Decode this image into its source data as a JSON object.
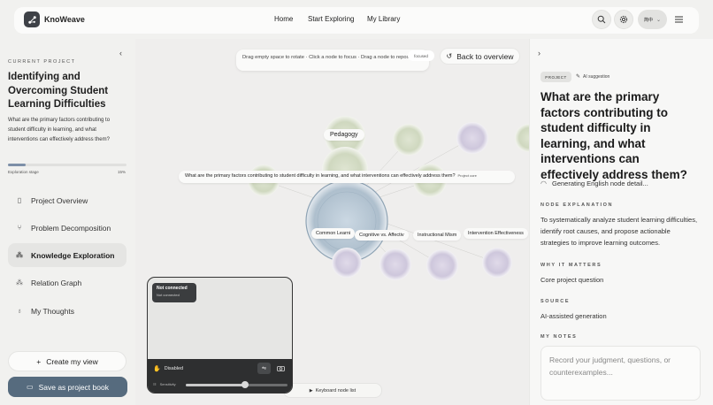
{
  "app": {
    "name": "KnoWeave"
  },
  "header": {
    "nav": [
      "Home",
      "Start Exploring",
      "My Library"
    ],
    "lang_label": "简中",
    "icons": [
      "search-icon",
      "gear-icon",
      "translate-icon",
      "menu-icon"
    ]
  },
  "sidebar": {
    "current_project_label": "CURRENT PROJECT",
    "project_title": "Identifying and Overcoming Student Learning Difficulties",
    "project_desc": "What are the primary factors contributing to student difficulty in learning, and what interventions can effectively address them?",
    "stage_label": "Exploration stage",
    "stage_percent": "15%",
    "stage_progress": 0.15,
    "items": [
      {
        "label": "Project Overview",
        "icon": "book-icon",
        "active": false
      },
      {
        "label": "Problem Decomposition",
        "icon": "branch-icon",
        "active": false
      },
      {
        "label": "Knowledge Exploration",
        "icon": "network-icon",
        "active": true
      },
      {
        "label": "Relation Graph",
        "icon": "graph-icon",
        "active": false
      },
      {
        "label": "My Thoughts",
        "icon": "bulb-icon",
        "active": false
      }
    ],
    "create_view_label": "Create my view",
    "save_book_label": "Save as project book"
  },
  "canvas": {
    "hint": "Drag empty space to rotate · Click a node to focus · Drag a node to reposition",
    "focused_badge": "focused",
    "back_label": "Back to overview",
    "core_question": "What are the primary factors contributing to student difficulty in learning, and what interventions can effectively address them?",
    "core_tag": "Project core",
    "node_labels": {
      "pedagogy": "Pedagogy",
      "common": "Common Learni",
      "cognitive": "Cognitive vs. Affectiv",
      "instructional": "Instructional Mism",
      "intervention": "Intervention Effectiveness"
    },
    "keyboard_list_label": "Keyboard node list"
  },
  "camera": {
    "status_title": "Not connected",
    "status_sub": "Not connected",
    "disabled_label": "Disabled",
    "sensitivity_label": "Sensitivity",
    "sensitivity_value": 0.58
  },
  "detail": {
    "pill": "PROJECT",
    "ai_suggestion": "AI suggestion",
    "title": "What are the primary factors contributing to student difficulty in learning, and what interventions can effectively address them?",
    "generating": "Generating English node detail...",
    "node_explanation_label": "NODE EXPLANATION",
    "node_explanation": "To systematically analyze student learning difficulties, identify root causes, and propose actionable strategies to improve learning outcomes.",
    "why_label": "WHY IT MATTERS",
    "why_text": "Core project question",
    "source_label": "SOURCE",
    "source_text": "AI-assisted generation",
    "notes_label": "MY NOTES",
    "notes_placeholder": "Record your judgment, questions, or counterexamples..."
  },
  "colors": {
    "accent": "#566b7e",
    "progress": "#7d8fa8",
    "node_focus": "#b7c8d6",
    "node_green": "#d2ddc4",
    "node_purple": "#d4cee0"
  }
}
